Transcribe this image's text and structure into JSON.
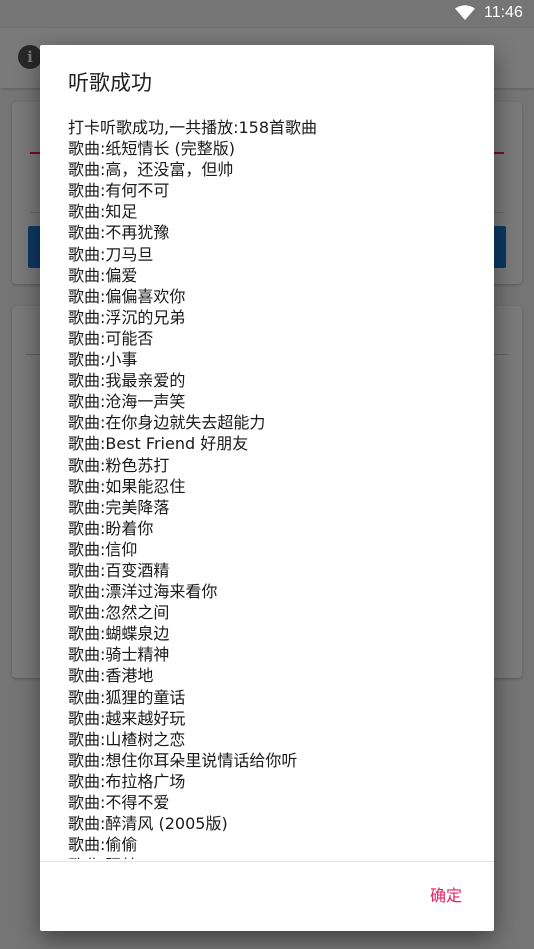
{
  "status_bar": {
    "time": "11:46"
  },
  "dialog": {
    "title": "听歌成功",
    "summary": "打卡听歌成功,一共播放:158首歌曲",
    "songs": [
      "歌曲:纸短情长 (完整版)",
      "歌曲:高，还没富，但帅",
      "歌曲:有何不可",
      "歌曲:知足",
      "歌曲:不再犹豫",
      "歌曲:刀马旦",
      "歌曲:偏爱",
      "歌曲:偏偏喜欢你",
      "歌曲:浮沉的兄弟",
      "歌曲:可能否",
      "歌曲:小事",
      "歌曲:我最亲爱的",
      "歌曲:沧海一声笑",
      "歌曲:在你身边就失去超能力",
      "歌曲:Best Friend 好朋友",
      "歌曲:粉色苏打",
      "歌曲:如果能忍住",
      "歌曲:完美降落",
      "歌曲:盼着你",
      "歌曲:信仰",
      "歌曲:百变酒精",
      "歌曲:漂洋过海来看你",
      "歌曲:忽然之间",
      "歌曲:蝴蝶泉边",
      "歌曲:骑士精神",
      "歌曲:香港地",
      "歌曲:狐狸的童话",
      "歌曲:越来越好玩",
      "歌曲:山楂树之恋",
      "歌曲:想住你耳朵里说情话给你听",
      "歌曲:布拉格广场",
      "歌曲:不得不爱",
      "歌曲:醉清风 (2005版)",
      "歌曲:偷偷",
      "歌曲:驿梦"
    ],
    "confirm_label": "确定"
  },
  "colors": {
    "accent": "#e91e63",
    "primary": "#1976d2"
  },
  "icons": {
    "status_wifi": "wifi-icon",
    "toolbar_info": "info-icon"
  }
}
